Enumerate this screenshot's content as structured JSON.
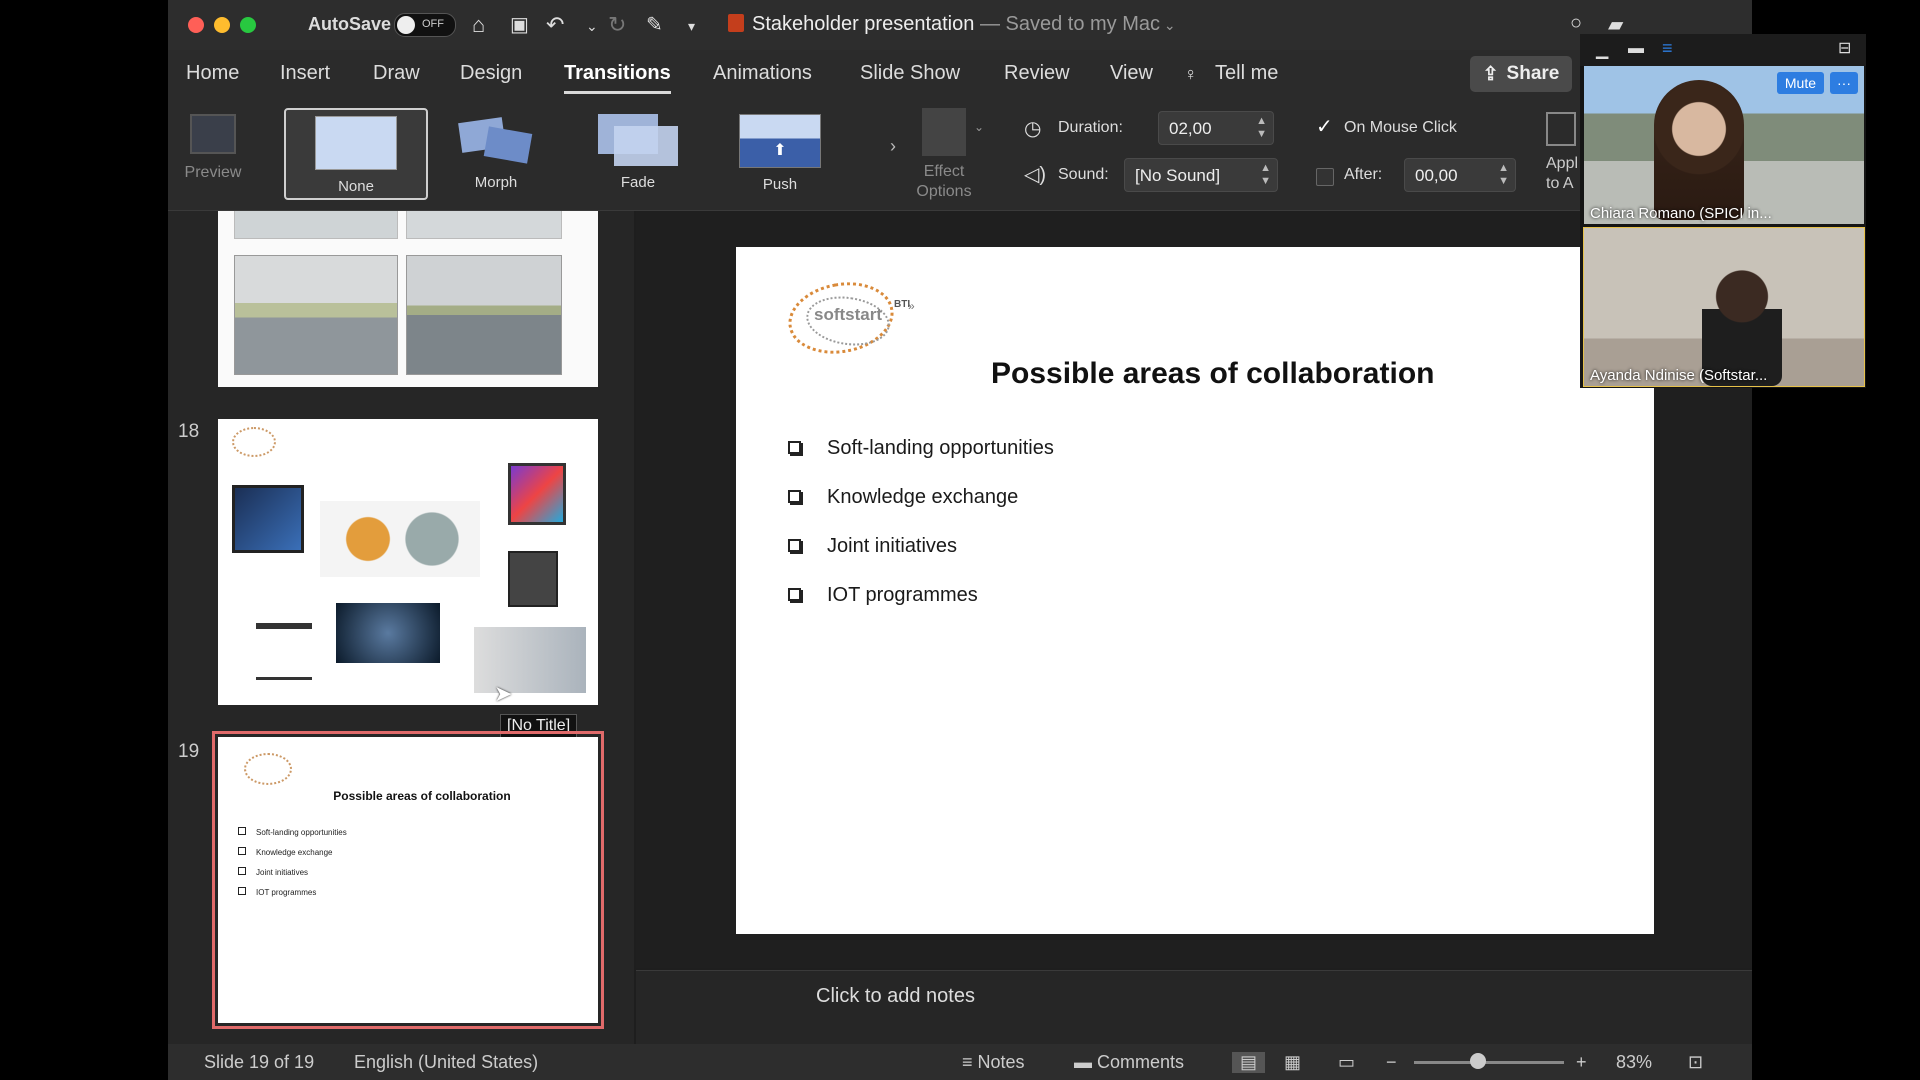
{
  "window": {
    "autosave_label": "AutoSave",
    "autosave_state": "OFF",
    "doc_title": "Stakeholder presentation",
    "saved_status": "— Saved to my Mac"
  },
  "tabs": [
    "Home",
    "Insert",
    "Draw",
    "Design",
    "Transitions",
    "Animations",
    "Slide Show",
    "Review",
    "View",
    "Tell me"
  ],
  "active_tab": "Transitions",
  "share_label": "Share",
  "ribbon": {
    "preview_label": "Preview",
    "transitions": [
      "None",
      "Morph",
      "Fade",
      "Push"
    ],
    "selected_transition": "None",
    "effect_options_label_1": "Effect",
    "effect_options_label_2": "Options",
    "duration_label": "Duration:",
    "duration_value": "02,00",
    "sound_label": "Sound:",
    "sound_value": "[No Sound]",
    "on_mouse_click_label": "On Mouse Click",
    "after_label": "After:",
    "after_value": "00,00",
    "apply_label_1": "Appl",
    "apply_label_2": "to A"
  },
  "slides_panel": {
    "slide_18_number": "18",
    "slide_19_number": "19",
    "tooltip": "[No Title]",
    "thumb_title": "Possible areas of collaboration",
    "thumb_bullets": [
      "Soft-landing opportunities",
      "Knowledge exchange",
      "Joint initiatives",
      "IOT programmes"
    ]
  },
  "slide": {
    "logo_text": "softstart",
    "logo_superscript": "BTI",
    "title": "Possible areas of collaboration",
    "bullets": [
      "Soft-landing opportunities",
      "Knowledge exchange",
      "Joint initiatives",
      "IOT programmes"
    ]
  },
  "notes_placeholder": "Click to add notes",
  "status": {
    "slide_count": "Slide 19 of 19",
    "language": "English (United States)",
    "notes_label": "Notes",
    "comments_label": "Comments",
    "zoom": "83%"
  },
  "video": {
    "participant_1": "Chiara Romano (SPICI in...",
    "participant_2": "Ayanda Ndinise (Softstar...",
    "mute_label": "Mute",
    "more_label": "···"
  },
  "colors": {
    "accent_selection": "#e06a6a",
    "zoom_blue": "#2d7de1"
  }
}
